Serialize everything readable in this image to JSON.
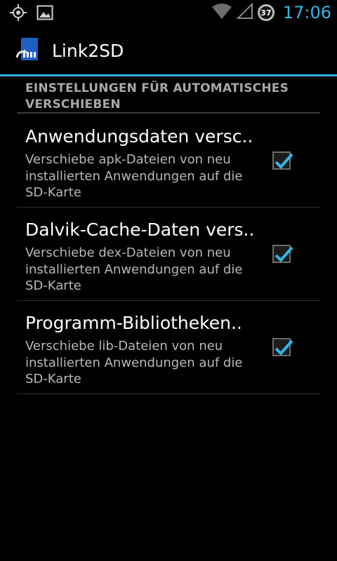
{
  "status_bar": {
    "time": "17:06",
    "battery_level": "37",
    "icons": [
      "gps-icon",
      "image-notification-icon",
      "wifi-icon",
      "signal-icon",
      "battery-icon"
    ]
  },
  "action_bar": {
    "title": "Link2SD",
    "icon": "link2sd-app-icon",
    "accent_color": "#33b5e5"
  },
  "category": {
    "title": "EINSTELLUNGEN FÜR AUTOMATISCHES VERSCHIEBEN"
  },
  "preferences": [
    {
      "title": "Anwendungsdaten versc..",
      "summary": "Verschiebe apk-Dateien von neu installierten Anwendungen auf die SD-Karte",
      "checked": true
    },
    {
      "title": "Dalvik-Cache-Daten vers..",
      "summary": "Verschiebe dex-Dateien von neu installierten Anwendungen auf die SD-Karte",
      "checked": true
    },
    {
      "title": "Programm-Bibliotheken..",
      "summary": "Verschiebe lib-Dateien von neu installierten Anwendungen auf die SD-Karte",
      "checked": true
    }
  ]
}
